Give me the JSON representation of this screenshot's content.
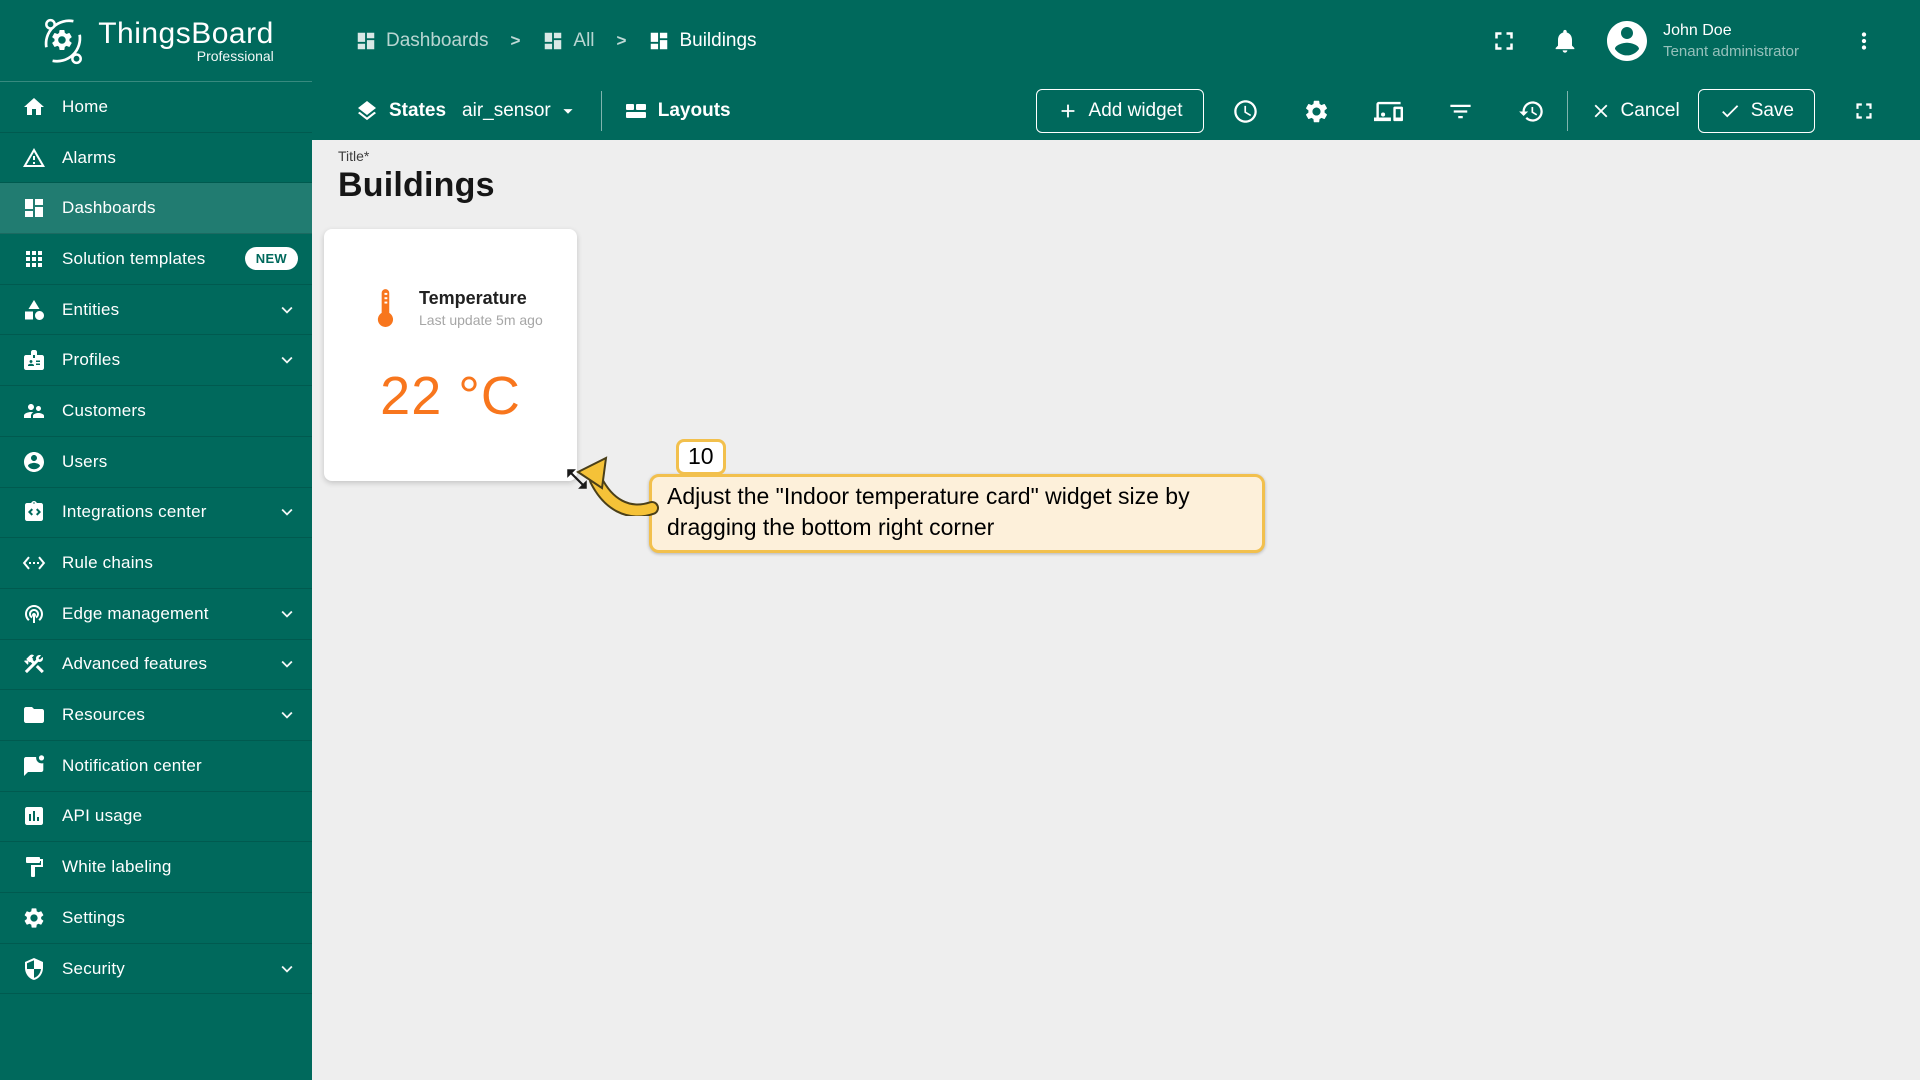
{
  "brand": {
    "name": "ThingsBoard",
    "edition": "Professional"
  },
  "breadcrumb": {
    "separator": ">",
    "items": [
      {
        "label": "Dashboards"
      },
      {
        "label": "All"
      },
      {
        "label": "Buildings"
      }
    ]
  },
  "header": {
    "user_name": "John Doe",
    "user_role": "Tenant administrator",
    "icons": [
      "fullscreen-icon",
      "notifications-icon",
      "avatar-icon",
      "more-vert-icon"
    ]
  },
  "toolbar": {
    "states_label": "States",
    "state_value": "air_sensor",
    "layouts_label": "Layouts",
    "add_widget_label": "Add widget",
    "cancel_label": "Cancel",
    "save_label": "Save",
    "icons": [
      "time-window-icon",
      "dashboard-settings-icon",
      "manage-layouts-icon",
      "filter-icon",
      "version-history-icon",
      "fullscreen-icon"
    ]
  },
  "sidebar": {
    "items": [
      {
        "label": "Home",
        "icon": "home-icon"
      },
      {
        "label": "Alarms",
        "icon": "alarms-icon"
      },
      {
        "label": "Dashboards",
        "icon": "dashboards-icon",
        "selected": true
      },
      {
        "label": "Solution templates",
        "icon": "solution-templates-icon",
        "badge": "NEW"
      },
      {
        "label": "Entities",
        "icon": "entities-icon",
        "expandable": true
      },
      {
        "label": "Profiles",
        "icon": "profiles-icon",
        "expandable": true
      },
      {
        "label": "Customers",
        "icon": "customers-icon"
      },
      {
        "label": "Users",
        "icon": "users-icon"
      },
      {
        "label": "Integrations center",
        "icon": "integrations-center-icon",
        "expandable": true
      },
      {
        "label": "Rule chains",
        "icon": "rule-chains-icon"
      },
      {
        "label": "Edge management",
        "icon": "edge-management-icon",
        "expandable": true
      },
      {
        "label": "Advanced features",
        "icon": "advanced-features-icon",
        "expandable": true
      },
      {
        "label": "Resources",
        "icon": "resources-icon",
        "expandable": true
      },
      {
        "label": "Notification center",
        "icon": "notification-center-icon"
      },
      {
        "label": "API usage",
        "icon": "api-usage-icon"
      },
      {
        "label": "White labeling",
        "icon": "white-labeling-icon"
      },
      {
        "label": "Settings",
        "icon": "settings-icon"
      },
      {
        "label": "Security",
        "icon": "security-icon",
        "expandable": true
      }
    ]
  },
  "main": {
    "title_label": "Title*",
    "title": "Buildings"
  },
  "widget": {
    "title": "Temperature",
    "last_update": "Last update 5m ago",
    "value": "22 °C",
    "icon": "thermometer-icon"
  },
  "assist": {
    "step": "10",
    "text": "Adjust the \"Indoor temperature card\" widget size by dragging the bottom right corner"
  },
  "colors": {
    "primary_teal": "#00695c",
    "accent_orange": "#f8761d",
    "content_bg": "#eeeeee",
    "tooltip_bg": "#fdf0da",
    "tooltip_border": "#f2c04d",
    "badge_new_bg": "#ffffff"
  }
}
